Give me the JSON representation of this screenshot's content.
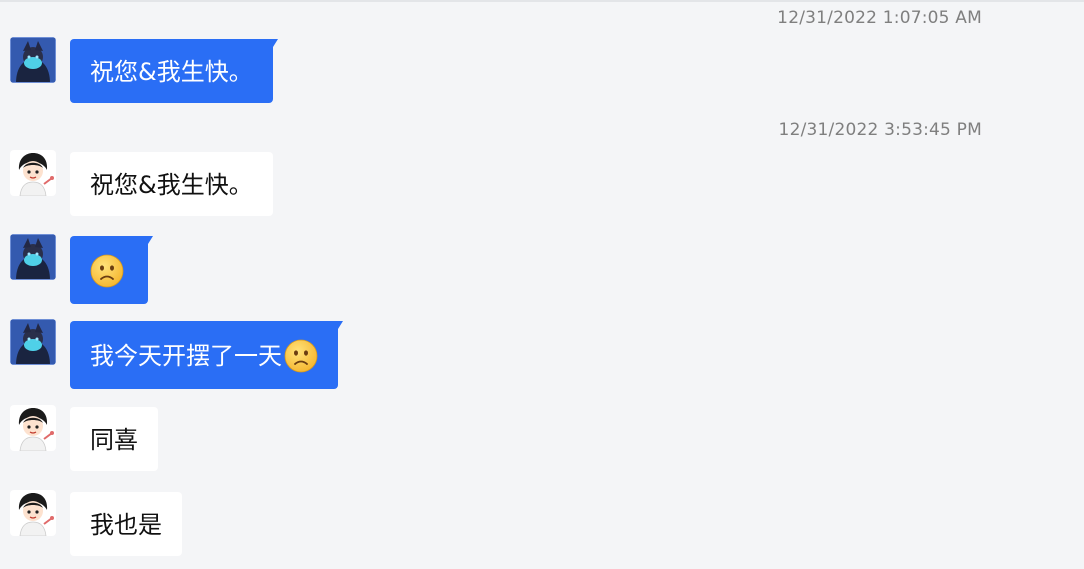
{
  "conversation": {
    "timestamps": {
      "first": "12/31/2022 1:07:05 AM",
      "second": "12/31/2022 3:53:45 PM"
    },
    "messages": [
      {
        "sender": "me",
        "text": "祝您&我生快。",
        "emoji": null
      },
      {
        "sender": "other",
        "text": "祝您&我生快。",
        "emoji": null
      },
      {
        "sender": "me",
        "text": "",
        "emoji": "frowning-face"
      },
      {
        "sender": "me",
        "text": "我今天开摆了一天",
        "emoji": "frowning-face"
      },
      {
        "sender": "other",
        "text": "同喜",
        "emoji": null
      },
      {
        "sender": "other",
        "text": "我也是",
        "emoji": null
      }
    ]
  },
  "colors": {
    "background": "#f4f5f7",
    "my_bubble": "#2a6ef5",
    "their_bubble": "#ffffff",
    "timestamp": "#7f7f7f"
  }
}
